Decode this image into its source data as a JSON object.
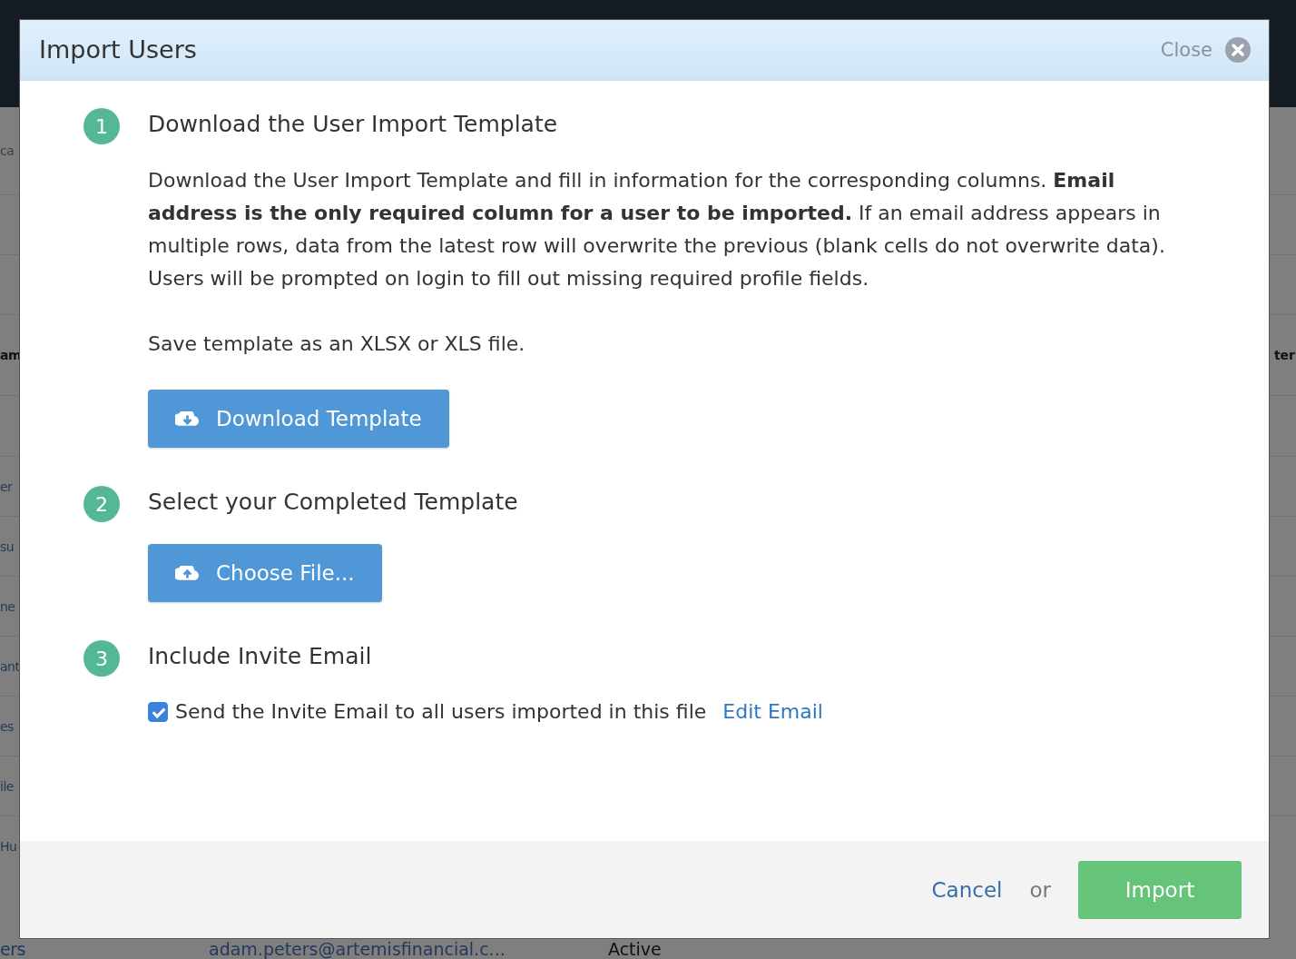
{
  "background": {
    "rows": [
      {
        "left": "ca",
        "right": "",
        "kind": "muted"
      },
      {
        "left": "",
        "right": "",
        "kind": "muted"
      },
      {
        "left": "",
        "right": "",
        "kind": "muted"
      },
      {
        "left": "am",
        "right": "ter",
        "kind": "heading"
      },
      {
        "left": "",
        "right": "",
        "kind": "muted"
      },
      {
        "left": "er",
        "right": "",
        "kind": "link"
      },
      {
        "left": "su",
        "right": "",
        "kind": "link"
      },
      {
        "left": "ne",
        "right": "",
        "kind": "link"
      },
      {
        "left": "ant",
        "right": "",
        "kind": "link"
      },
      {
        "left": "es",
        "right": "",
        "kind": "link"
      },
      {
        "left": "ile",
        "right": "",
        "kind": "link"
      },
      {
        "left": "Hu",
        "right": "",
        "kind": "link"
      }
    ],
    "last_row": {
      "name": "ers",
      "email": "adam.peters@artemisfinancial.c...",
      "status": "Active"
    }
  },
  "modal": {
    "title": "Import Users",
    "close_label": "Close",
    "steps": [
      {
        "number": "1",
        "title": "Download the User Import Template",
        "description": "Download the User Import Template and fill in information for the corresponding columns. **Email address is the only required column for a user to be imported.** If an email address appears in multiple rows, data from the latest row will overwrite the previous (blank cells do not overwrite data). Users will be prompted on login to fill out missing required profile fields.",
        "note": "Save template as an XLSX or XLS file.",
        "button": {
          "label": "Download Template"
        }
      },
      {
        "number": "2",
        "title": "Select your Completed Template",
        "button": {
          "label": "Choose File..."
        }
      },
      {
        "number": "3",
        "title": "Include Invite Email",
        "checkbox": {
          "label": "Send the Invite Email to all users imported in this file",
          "checked": true
        },
        "link": "Edit Email"
      }
    ],
    "footer": {
      "cancel": "Cancel",
      "or": "or",
      "import": "Import"
    }
  }
}
